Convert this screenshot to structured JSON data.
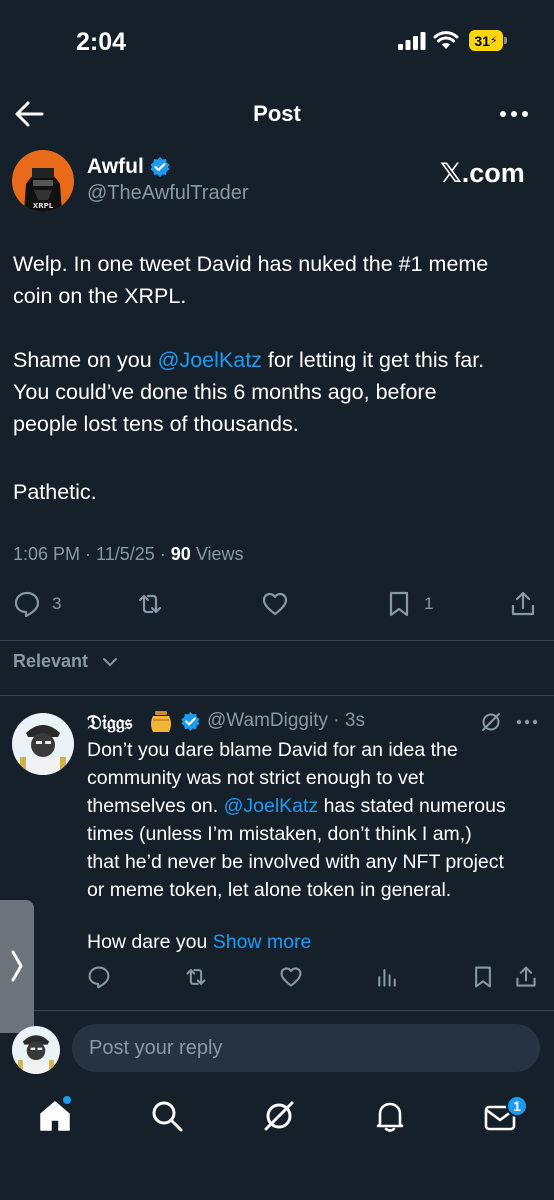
{
  "status_bar": {
    "time": "2:04",
    "battery": "31"
  },
  "header": {
    "title": "Post"
  },
  "post": {
    "author_name": "Awful",
    "author_handle": "@TheAwfulTrader",
    "source": "𝕏.com",
    "text_line1": "Welp. In one tweet David has nuked the #1 meme",
    "text_line2": "coin on the XRPL.",
    "text_p2_prefix": "Shame on you ",
    "text_p2_mention": "@JoelKatz",
    "text_p2_suffix": " for letting it get this far.",
    "text_line4": "You could’ve done this 6 months ago, before",
    "text_line5": "people lost tens of thousands.",
    "text_line6": "Pathetic.",
    "time": "1:06 PM",
    "date": "11/5/25",
    "views_count": "90",
    "views_label": "Views",
    "replies": "3",
    "bookmarks": "1"
  },
  "filter": {
    "label": "Relevant"
  },
  "reply": {
    "name": "𝔇𝔦𝔤𝔤𝔰",
    "handle": "@WamDiggity · 3s",
    "line1": "Don’t you dare blame David for an idea the",
    "line2": "community was not strict enough to vet",
    "line3": "themselves on.",
    "line3_mention": "@JoelKatz",
    "line3_suffix": " has stated numerous",
    "line4": "times (unless I’m mistaken, don’t think I am,)",
    "line5": "that he’d never be involved with any NFT project",
    "line6": "or meme token, let alone token in general.",
    "line7": "How dare you ",
    "show_more": "Show more"
  },
  "compose": {
    "placeholder": "Post your reply"
  },
  "nav": {
    "messages_badge": "1"
  },
  "colors": {
    "background": "#15202b",
    "accent": "#1d9bf0",
    "muted": "#8899a6",
    "divider": "#38444d"
  },
  "icons": {
    "back": "back-arrow-icon",
    "more": "more-icon",
    "verified": "verified-badge-icon",
    "reply": "reply-icon",
    "repost": "repost-icon",
    "like": "heart-icon",
    "bookmark": "bookmark-icon",
    "share": "share-icon",
    "analytics": "analytics-icon",
    "grok": "grok-icon",
    "home": "home-icon",
    "search": "search-icon",
    "notifications": "bell-icon",
    "messages": "mail-icon"
  }
}
